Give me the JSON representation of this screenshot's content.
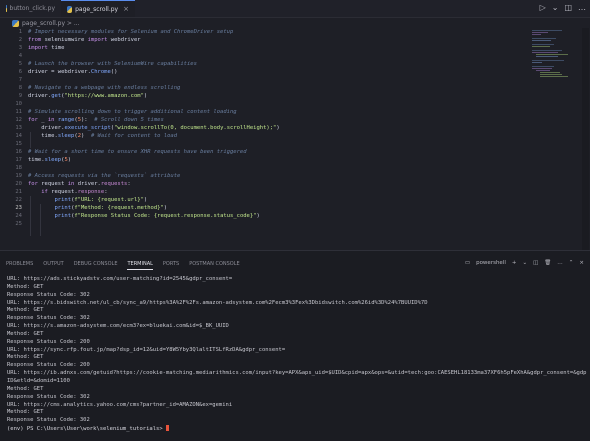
{
  "tabs": [
    {
      "label": "button_click.py",
      "active": false
    },
    {
      "label": "page_scroll.py",
      "active": true
    }
  ],
  "breadcrumb": "page_scroll.py > ...",
  "editor": {
    "current_line": 23,
    "lines": [
      {
        "n": 1,
        "t": [
          [
            "cm",
            "# Import necessary modules for Selenium and ChromeDriver setup"
          ]
        ]
      },
      {
        "n": 2,
        "t": [
          [
            "kw",
            "from "
          ],
          [
            "var",
            "seleniumwire "
          ],
          [
            "kw",
            "import "
          ],
          [
            "var",
            "webdriver"
          ]
        ]
      },
      {
        "n": 3,
        "t": [
          [
            "kw",
            "import "
          ],
          [
            "var",
            "time"
          ]
        ]
      },
      {
        "n": 4,
        "t": []
      },
      {
        "n": 5,
        "t": [
          [
            "cm",
            "# Launch the browser with SeleniumWire capabilities"
          ]
        ]
      },
      {
        "n": 6,
        "t": [
          [
            "var",
            "driver = webdriver."
          ],
          [
            "fn",
            "Chrome"
          ],
          [
            "var",
            "()"
          ]
        ]
      },
      {
        "n": 7,
        "t": []
      },
      {
        "n": 8,
        "t": [
          [
            "cm",
            "# Navigate to a webpage with endless scrolling"
          ]
        ]
      },
      {
        "n": 9,
        "t": [
          [
            "var",
            "driver."
          ],
          [
            "fn",
            "get"
          ],
          [
            "var",
            "("
          ],
          [
            "str",
            "\"https://www.amazon.com\""
          ],
          [
            "var",
            ")"
          ]
        ]
      },
      {
        "n": 10,
        "t": []
      },
      {
        "n": 11,
        "t": [
          [
            "cm",
            "# Simulate scrolling down to trigger additional content loading"
          ]
        ]
      },
      {
        "n": 12,
        "t": [
          [
            "kw",
            "for "
          ],
          [
            "var",
            "_ "
          ],
          [
            "kw",
            "in "
          ],
          [
            "fn",
            "range"
          ],
          [
            "var",
            "("
          ],
          [
            "num",
            "5"
          ],
          [
            "var",
            "):  "
          ],
          [
            "cm",
            "# Scroll down 5 times"
          ]
        ]
      },
      {
        "n": 13,
        "t": [
          [
            "var",
            "    driver."
          ],
          [
            "fn",
            "execute_script"
          ],
          [
            "var",
            "("
          ],
          [
            "str",
            "\"window.scrollTo(0, document.body.scrollHeight);\""
          ],
          [
            "var",
            ")"
          ]
        ]
      },
      {
        "n": 14,
        "t": [
          [
            "var",
            "    time."
          ],
          [
            "fn",
            "sleep"
          ],
          [
            "var",
            "("
          ],
          [
            "num",
            "2"
          ],
          [
            "var",
            ")  "
          ],
          [
            "cm",
            "# Wait for content to load"
          ]
        ]
      },
      {
        "n": 15,
        "t": []
      },
      {
        "n": 16,
        "t": [
          [
            "cm",
            "# Wait for a short time to ensure XHR requests have been triggered"
          ]
        ]
      },
      {
        "n": 17,
        "t": [
          [
            "var",
            "time."
          ],
          [
            "fn",
            "sleep"
          ],
          [
            "var",
            "("
          ],
          [
            "num",
            "5"
          ],
          [
            "var",
            ")"
          ]
        ]
      },
      {
        "n": 18,
        "t": []
      },
      {
        "n": 19,
        "t": [
          [
            "cm",
            "# Access requests via the `requests` attribute"
          ]
        ]
      },
      {
        "n": 20,
        "t": [
          [
            "kw",
            "for "
          ],
          [
            "var",
            "request "
          ],
          [
            "kw",
            "in "
          ],
          [
            "var",
            "driver."
          ],
          [
            "attr",
            "requests"
          ],
          [
            "var",
            ":"
          ]
        ]
      },
      {
        "n": 21,
        "t": [
          [
            "var",
            "    "
          ],
          [
            "kw",
            "if "
          ],
          [
            "var",
            "request."
          ],
          [
            "attr",
            "response"
          ],
          [
            "var",
            ":"
          ]
        ]
      },
      {
        "n": 22,
        "t": [
          [
            "var",
            "        "
          ],
          [
            "fn",
            "print"
          ],
          [
            "var",
            "("
          ],
          [
            "str",
            "f\"URL: {request.url}\""
          ],
          [
            "var",
            ")"
          ]
        ]
      },
      {
        "n": 23,
        "t": [
          [
            "var",
            "        "
          ],
          [
            "fn",
            "print"
          ],
          [
            "var",
            "("
          ],
          [
            "str",
            "f\"Method: {request.method}\""
          ],
          [
            "var",
            ")"
          ]
        ]
      },
      {
        "n": 24,
        "t": [
          [
            "var",
            "        "
          ],
          [
            "fn",
            "print"
          ],
          [
            "var",
            "("
          ],
          [
            "str",
            "f\"Response Status Code: {request.response.status_code}\""
          ],
          [
            "var",
            ")"
          ]
        ]
      },
      {
        "n": 25,
        "t": []
      }
    ]
  },
  "panel": {
    "tabs": [
      {
        "label": "PROBLEMS",
        "active": false
      },
      {
        "label": "OUTPUT",
        "active": false
      },
      {
        "label": "DEBUG CONSOLE",
        "active": false
      },
      {
        "label": "TERMINAL",
        "active": true
      },
      {
        "label": "PORTS",
        "active": false
      },
      {
        "label": "POSTMAN CONSOLE",
        "active": false
      }
    ],
    "shell_label": "powershell",
    "terminal_lines": [
      "URL: https://ads.stickyadstv.com/user-matching?id=2545&gdpr_consent=",
      "Method: GET",
      "Response Status Code: 302",
      "URL: https://s.bidswitch.net/ul_cb/sync_a9/https%3A%2F%2Fs.amazon-adsystem.com%2Fecm3%3Fex%3Dbidswitch.com%26id%3D%24%7BUUID%7D",
      "Method: GET",
      "Response Status Code: 302",
      "URL: https://s.amazon-adsystem.com/ecm3?ex=bluekai.com&id=$_BK_UUID",
      "Method: GET",
      "Response Status Code: 200",
      "URL: https://sync.rfp.fout.jp/map?dsp_id=12&uid=Y8W5Yby3QlaltITSLfRzDA&gdpr_consent=",
      "Method: GET",
      "Response Status Code: 200",
      "URL: https://ib.adnxs.com/getuid?https://cookie-matching.mediarithmics.com/input?key=APX&aps_uid=$UID&cpid=apx&ops=&utid=tech:goo:CAESEHL18133ma37XF6h5pFeXhA&gdpr_consent=&gdpr=0&action=GET_",
      "ID&etld=&domid=1100",
      "Method: GET",
      "Response Status Code: 302",
      "URL: https://cms.analytics.yahoo.com/cms?partner_id=AMAZON&ex=gemini",
      "Method: GET",
      "Response Status Code: 302"
    ],
    "prompt": "(env) PS C:\\Users\\User\\work\\selenium_tutorials> "
  },
  "colors": {
    "accent": "#5a8dee",
    "background": "#1e1f26",
    "cursor": "#e8543c"
  }
}
